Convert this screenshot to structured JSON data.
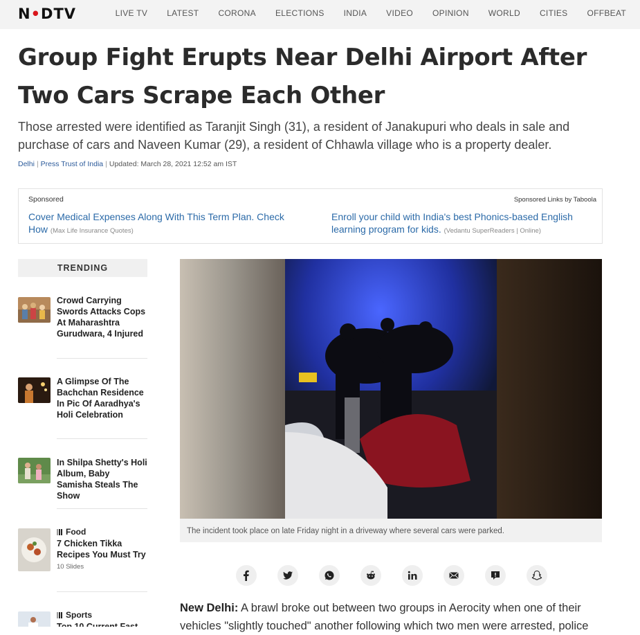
{
  "header": {
    "logo": "NDTV",
    "nav": [
      "LIVE TV",
      "LATEST",
      "CORONA",
      "ELECTIONS",
      "INDIA",
      "VIDEO",
      "OPINION",
      "WORLD",
      "CITIES",
      "OFFBEAT"
    ]
  },
  "article": {
    "headline": "Group Fight Erupts Near Delhi Airport After Two Cars Scrape Each Other",
    "summary": "Those arrested were identified as Taranjit Singh (31), a resident of Janakupuri who deals in sale and purchase of cars and Naveen Kumar (29), a resident of Chhawla village who is a property dealer.",
    "byline": {
      "city": "Delhi",
      "source": "Press Trust of India",
      "updated": "Updated: March 28, 2021 12:52 am IST"
    },
    "image_caption": "The incident took place on late Friday night in a driveway where several cars were parked.",
    "body_lead": "New Delhi:",
    "body_text": " A brawl broke out between two groups in Aerocity when one of their vehicles \"slightly touched\" another following which two men were arrested, police"
  },
  "sponsored": {
    "label": "Sponsored",
    "taboola": "Sponsored Links by Taboola",
    "links": [
      {
        "title": "Cover Medical Expenses Along With This Term Plan. Check How",
        "source": "(Max Life Insurance Quotes)"
      },
      {
        "title": "Enroll your child with India's best Phonics-based English learning program for kids.",
        "source": "(Vedantu SuperReaders | Online)"
      }
    ]
  },
  "trending": {
    "heading": "TRENDING",
    "items": [
      {
        "title": "Crowd Carrying Swords Attacks Cops At Maharashtra Gurudwara, 4 Injured"
      },
      {
        "title": "A Glimpse Of The Bachchan Residence In Pic Of Aaradhya's Holi Celebration"
      },
      {
        "title": "In Shilpa Shetty's Holi Album, Baby Samisha Steals The Show"
      },
      {
        "category": "Food",
        "title": "7 Chicken Tikka Recipes You Must Try",
        "slides": "10 Slides"
      },
      {
        "category": "Sports",
        "title": "Top 10 Current Fast"
      }
    ]
  },
  "share": {
    "icons": [
      "facebook-icon",
      "twitter-icon",
      "whatsapp-icon",
      "reddit-icon",
      "linkedin-icon",
      "email-icon",
      "comment-icon",
      "snapchat-icon"
    ]
  },
  "colors": {
    "link": "#2b6aa8",
    "logo_red": "#d9161c",
    "nav_bg": "#f3f3f3"
  }
}
